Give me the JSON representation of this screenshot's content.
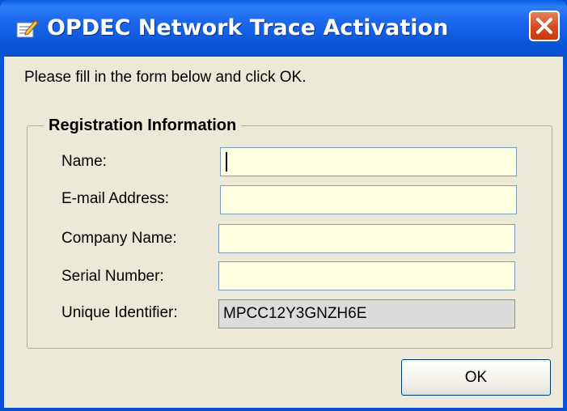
{
  "window": {
    "title": "OPDEC Network Trace Activation",
    "title_icon": "form-edit-icon",
    "close_icon": "close-icon"
  },
  "prompt": "Please fill in the form below and click OK.",
  "group": {
    "legend": "Registration Information",
    "fields": [
      {
        "label": "Name:",
        "value": "",
        "placeholder": "",
        "readonly": false,
        "focused": true
      },
      {
        "label": "E-mail Address:",
        "value": "",
        "placeholder": "",
        "readonly": false
      },
      {
        "label": "Company Name:",
        "value": "",
        "placeholder": "",
        "readonly": false
      },
      {
        "label": "Serial Number:",
        "value": "",
        "placeholder": "",
        "readonly": false
      },
      {
        "label": "Unique Identifier:",
        "value": "MPCC12Y3GNZH6E",
        "placeholder": "",
        "readonly": true
      }
    ]
  },
  "buttons": {
    "ok_label": "OK"
  },
  "colors": {
    "titlebar": "#0a55d6",
    "face": "#ece9d8",
    "input_bg": "#ffffe1",
    "readonly_bg": "#dcdcdc",
    "close_button": "#d44b1f"
  }
}
